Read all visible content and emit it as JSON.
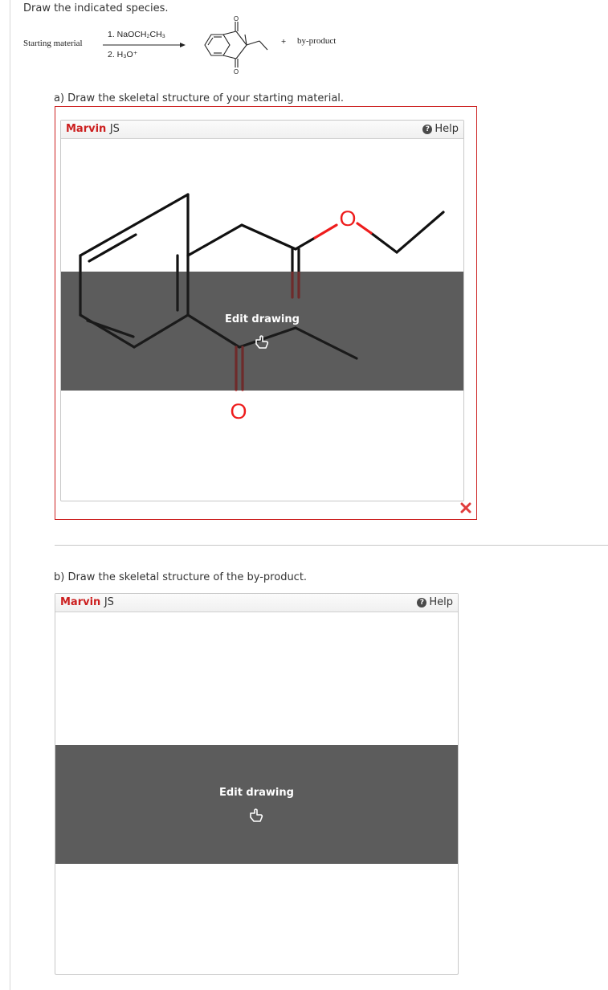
{
  "prompt": "Draw the indicated species.",
  "reaction": {
    "starting_material_label": "Starting material",
    "reagent_1": "1. NaOCH₂CH₃",
    "reagent_2": "2. H₃O⁺",
    "plus": "+",
    "byproduct_label": "by-product",
    "atom_o": "O"
  },
  "part_a": {
    "question": "a) Draw the skeletal structure of your starting material.",
    "editor_brand": "Marvin",
    "editor_brand_suffix": "JS",
    "help_label": "Help",
    "help_icon": "question-circle-icon",
    "edit_label": "Edit drawing",
    "atom_o": "O",
    "status_icon": "red-x-icon",
    "status_color": "#e03c3c"
  },
  "part_b": {
    "question": "b) Draw the skeletal structure of the by-product.",
    "editor_brand": "Marvin",
    "editor_brand_suffix": "JS",
    "help_label": "Help",
    "help_icon": "question-circle-icon",
    "edit_label": "Edit drawing"
  },
  "colors": {
    "brand": "#cc1f1f",
    "oxygen": "#ee1c1c",
    "overlay": "#5c5c5c",
    "border_incorrect": "#cc2222"
  }
}
